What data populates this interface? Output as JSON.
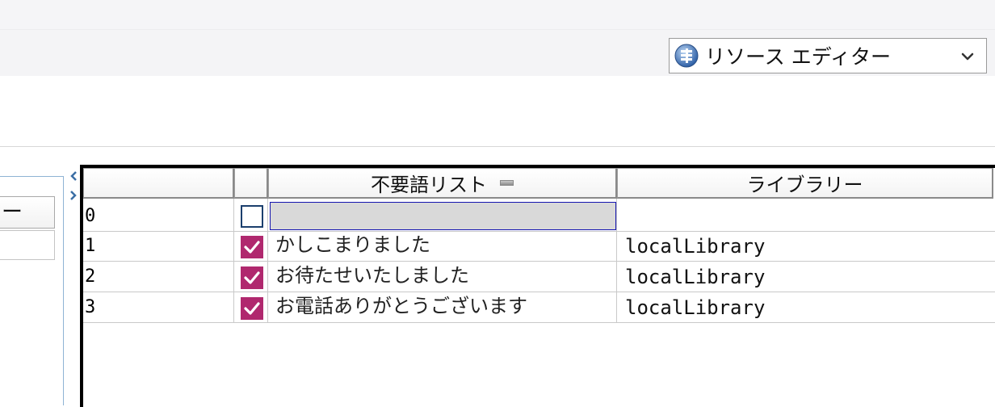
{
  "toolbar": {
    "perspective": {
      "icon": "perspective-icon",
      "label": "リソース エディター",
      "chevron_icon": "chevron-down-icon"
    }
  },
  "left_panel": {
    "button_label": "ー"
  },
  "table": {
    "columns": [
      {
        "label": ""
      },
      {
        "label": ""
      },
      {
        "label": "不要語リスト",
        "sort_icon": "sort-indicator-icon"
      },
      {
        "label": "ライブラリー"
      }
    ],
    "rows": [
      {
        "index": "0",
        "checked": false,
        "phrase": "",
        "library": "",
        "editing": true
      },
      {
        "index": "1",
        "checked": true,
        "phrase": "かしこまりました",
        "library": "localLibrary"
      },
      {
        "index": "2",
        "checked": true,
        "phrase": "お待たせいたしました",
        "library": "localLibrary"
      },
      {
        "index": "3",
        "checked": true,
        "phrase": "お電話ありがとうございます",
        "library": "localLibrary"
      }
    ]
  },
  "colors": {
    "checkbox_checked": "#b0286e",
    "edit_cell_border": "#1515b0"
  }
}
